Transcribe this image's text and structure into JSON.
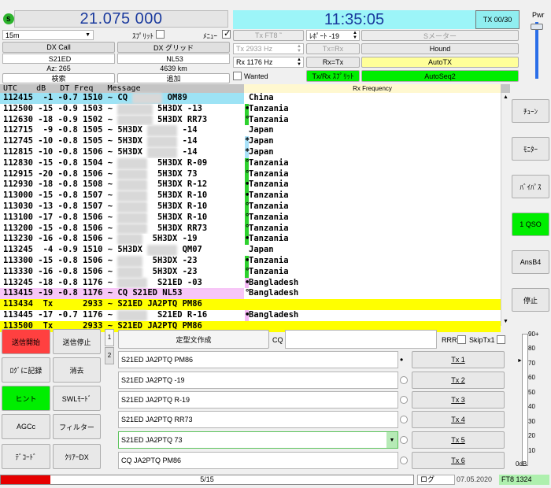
{
  "top": {
    "status_led": "S",
    "frequency": "21.075 000",
    "clock": "11:35:05",
    "tx_counter": "TX 00/30",
    "pwr_label": "Pwr"
  },
  "left_panel": {
    "band": "15m",
    "sprit_label": "ｽﾌﾟﾘｯﾄ",
    "menu_label": "ﾒﾆｭｰ",
    "dx_call_label": "DX Call",
    "dx_grid_label": "DX グリッド",
    "dx_call_value": "S21ED",
    "dx_grid_value": "NL53",
    "azimuth": "Az: 265",
    "distance": "4639 km",
    "lookup_button": "検索",
    "add_button": "追加"
  },
  "mid_panel": {
    "tx_mode_button": "Tx FT8 ˜",
    "report_label": "ﾚﾎﾟｰﾄ -19",
    "s_meter_button": "Sメーター",
    "tx_freq_field": "Tx  2933  Hz",
    "tx_eq_rx_button": "Tx=Rx",
    "hound_button": "Hound",
    "rx_freq_field": "Rx  1176  Hz",
    "rx_eq_tx_button": "Rx=Tx",
    "autotx_button": "AutoTX",
    "wanted_label": "Wanted",
    "txrx_split_button": "Tx/Rx ｽﾌﾟﾘｯﾄ",
    "autoseq_button": "AutoSeq2",
    "rx_frequency_label": "Rx Frequency"
  },
  "list": {
    "header": "UTC    dB   DT Freq   Message",
    "rows": [
      {
        "pre": "112415  -1 -0.7 1510 ~ CQ ",
        "blur": "BV2ABC",
        "post": " OM89",
        "country": "China",
        "marker": "",
        "bg": "#9de3f5",
        "cbg": "#ffffff",
        "mk": "",
        "mkcolor": ""
      },
      {
        "pre": "112500 -15 -0.9 1503 ~ ",
        "blur": "JJ1ABCD",
        "post": " 5H3DX -13",
        "country": "Tanzania",
        "marker": "•",
        "bg": "#ffffff",
        "cbg": "#ffffff",
        "mk": "#2ed12e",
        "mkcolor": ""
      },
      {
        "pre": "112630 -18 -0.9 1502 ~ ",
        "blur": "JA1AAAB",
        "post": " 5H3DX RR73",
        "country": "Tanzania",
        "marker": "°",
        "bg": "#ffffff",
        "cbg": "#ffffff",
        "mk": "#2ed12e",
        "mkcolor": ""
      },
      {
        "pre": "112715  -9 -0.8 1505 ~ 5H3DX ",
        "blur": "JA1AAA",
        "post": " -14",
        "country": "Japan",
        "marker": "",
        "bg": "#ffffff",
        "cbg": "#ffffff",
        "mk": "#a9e2fa",
        "mkcolor": ""
      },
      {
        "pre": "112745 -10 -0.8 1505 ~ 5H3DX ",
        "blur": "JA1AAA",
        "post": " -14",
        "country": "Japan",
        "marker": "*",
        "bg": "#ffffff",
        "cbg": "#ffffff",
        "mk": "#a9e2fa",
        "mkcolor": ""
      },
      {
        "pre": "112815 -10 -0.8 1506 ~ 5H3DX ",
        "blur": "JA1AAA",
        "post": " -14",
        "country": "Japan",
        "marker": "*",
        "bg": "#ffffff",
        "cbg": "#ffffff",
        "mk": "#a9e2fa",
        "mkcolor": ""
      },
      {
        "pre": "112830 -15 -0.8 1504 ~ ",
        "blur": "JA1AAA",
        "post": "  5H3DX R-09",
        "country": "Tanzania",
        "marker": "°",
        "bg": "#ffffff",
        "cbg": "#ffffff",
        "mk": "#2ed12e",
        "mkcolor": ""
      },
      {
        "pre": "112915 -20 -0.8 1506 ~ ",
        "blur": "JA1AAA",
        "post": "  5H3DX 73",
        "country": "Tanzania",
        "marker": "°",
        "bg": "#ffffff",
        "cbg": "#ffffff",
        "mk": "#2ed12e",
        "mkcolor": ""
      },
      {
        "pre": "112930 -18 -0.8 1508 ~ ",
        "blur": "JA1AAA",
        "post": "  5H3DX R-12",
        "country": "Tanzania",
        "marker": "•",
        "bg": "#ffffff",
        "cbg": "#ffffff",
        "mk": "#2ed12e",
        "mkcolor": ""
      },
      {
        "pre": "113000 -15 -0.8 1507 ~ ",
        "blur": "JA1AAA",
        "post": "  5H3DX R-10",
        "country": "Tanzania",
        "marker": "•",
        "bg": "#ffffff",
        "cbg": "#ffffff",
        "mk": "#2ed12e",
        "mkcolor": ""
      },
      {
        "pre": "113030 -13 -0.8 1507 ~ ",
        "blur": "JA1AAA",
        "post": "  5H3DX R-10",
        "country": "Tanzania",
        "marker": "°",
        "bg": "#ffffff",
        "cbg": "#ffffff",
        "mk": "#2ed12e",
        "mkcolor": ""
      },
      {
        "pre": "113100 -17 -0.8 1506 ~ ",
        "blur": "JA1AAA",
        "post": "  5H3DX R-10",
        "country": "Tanzania",
        "marker": "°",
        "bg": "#ffffff",
        "cbg": "#ffffff",
        "mk": "#2ed12e",
        "mkcolor": ""
      },
      {
        "pre": "113200 -15 -0.8 1506 ~ ",
        "blur": "JA1AAA",
        "post": "  5H3DX RR73",
        "country": "Tanzania",
        "marker": "°",
        "bg": "#ffffff",
        "cbg": "#ffffff",
        "mk": "#2ed12e",
        "mkcolor": ""
      },
      {
        "pre": "113230 -16 -0.8 1506 ~ ",
        "blur": "JA1AA",
        "post": "  5H3DX -19",
        "country": "Tanzania",
        "marker": "•",
        "bg": "#ffffff",
        "cbg": "#ffffff",
        "mk": "#2ed12e",
        "mkcolor": ""
      },
      {
        "pre": "113245  -4 -0.9 1510 ~ 5H3DX ",
        "blur": "JA1AAA",
        "post": " QM07",
        "country": "Japan",
        "marker": "",
        "bg": "#ffffff",
        "cbg": "#ffffff",
        "mk": "#a9e2fa",
        "mkcolor": ""
      },
      {
        "pre": "113300 -15 -0.8 1506 ~ ",
        "blur": "JA1AA",
        "post": "  5H3DX -23",
        "country": "Tanzania",
        "marker": "•",
        "bg": "#ffffff",
        "cbg": "#ffffff",
        "mk": "#2ed12e",
        "mkcolor": ""
      },
      {
        "pre": "113330 -16 -0.8 1506 ~ ",
        "blur": "JA1AA",
        "post": "  5H3DX -23",
        "country": "Tanzania",
        "marker": "°",
        "bg": "#ffffff",
        "cbg": "#ffffff",
        "mk": "#2ed12e",
        "mkcolor": ""
      },
      {
        "pre": "113245 -18 -0.8 1176 ~ ",
        "blur": "JA1AAA",
        "post": "  S21ED -03",
        "country": "Bangladesh",
        "marker": "•",
        "bg": "#ffffff",
        "cbg": "#ffffff",
        "mk": "#f5b8f5",
        "mkcolor": ""
      },
      {
        "pre": "113415 -19 -0.8 1176 ~ CQ S21ED NL53",
        "blur": "",
        "post": "",
        "country": "Bangladesh",
        "marker": "°",
        "bg": "#f7c6f7",
        "cbg": "#ffffff",
        "mk": "",
        "mkcolor": ""
      },
      {
        "pre": "113434  Tx      2933 ~ S21ED JA2PTQ PM86",
        "blur": "",
        "post": "",
        "country": "",
        "marker": "",
        "bg": "#ffff00",
        "cbg": "#ffff00",
        "mk": "",
        "mkcolor": ""
      },
      {
        "pre": "113445 -17 -0.7 1176 ~ ",
        "blur": "JA1AAA",
        "post": "  S21ED R-16",
        "country": "Bangladesh",
        "marker": "•",
        "bg": "#ffffff",
        "cbg": "#ffffff",
        "mk": "#f5b8f5",
        "mkcolor": ""
      },
      {
        "pre": "113500  Tx      2933 ~ S21ED JA2PTQ PM86",
        "blur": "",
        "post": "",
        "country": "",
        "marker": "",
        "bg": "#ffff00",
        "cbg": "#ffff00",
        "mk": "",
        "mkcolor": ""
      }
    ]
  },
  "side_buttons": {
    "tune": "ﾁｭｰﾝ",
    "monitor": "ﾓﾆﾀｰ",
    "bypass": "ﾊﾞｲﾊﾟｽ",
    "one_qso": "1 QSO",
    "ansb4": "AnsB4",
    "stop": "停止"
  },
  "bottom_left": {
    "tx_start": "送信開始",
    "tx_stop": "送信停止",
    "log": "ﾛｸﾞに記録",
    "erase": "消去",
    "hint": "ヒント",
    "swl": "SWLﾓｰﾄﾞ",
    "agcc": "AGCc",
    "filter": "フィルター",
    "decode": "ﾃﾞｺｰﾄﾞ",
    "clear_dx": "ｸﾘｱｰDX"
  },
  "macros": {
    "tab1": "1",
    "tab2": "2",
    "generate_button": "定型文作成",
    "cq_label": "CQ",
    "rrr_label": "RRR",
    "skip_label": "SkipTx1",
    "messages": [
      {
        "text": "S21ED JA2PTQ PM86",
        "tx": "Tx 1"
      },
      {
        "text": "S21ED JA2PTQ -19",
        "tx": "Tx 2"
      },
      {
        "text": "S21ED JA2PTQ R-19",
        "tx": "Tx 3"
      },
      {
        "text": "S21ED JA2PTQ RR73",
        "tx": "Tx 4"
      },
      {
        "text": "S21ED JA2PTQ 73",
        "tx": "Tx 5"
      },
      {
        "text": "CQ JA2PTQ PM86",
        "tx": "Tx 6"
      }
    ]
  },
  "meter": {
    "ticks": [
      "90+",
      "80",
      "70",
      "60",
      "50",
      "40",
      "30",
      "20",
      "10",
      "0dB"
    ]
  },
  "status": {
    "progress": "5/15",
    "log_label": "ログ",
    "date": "07.05.2020",
    "mode_info": "FT8   1324"
  },
  "colors": {
    "green": "#00ee00",
    "yellow_btn": "#ffff99",
    "red": "#ff3333",
    "cyan": "#9cf5f8"
  }
}
